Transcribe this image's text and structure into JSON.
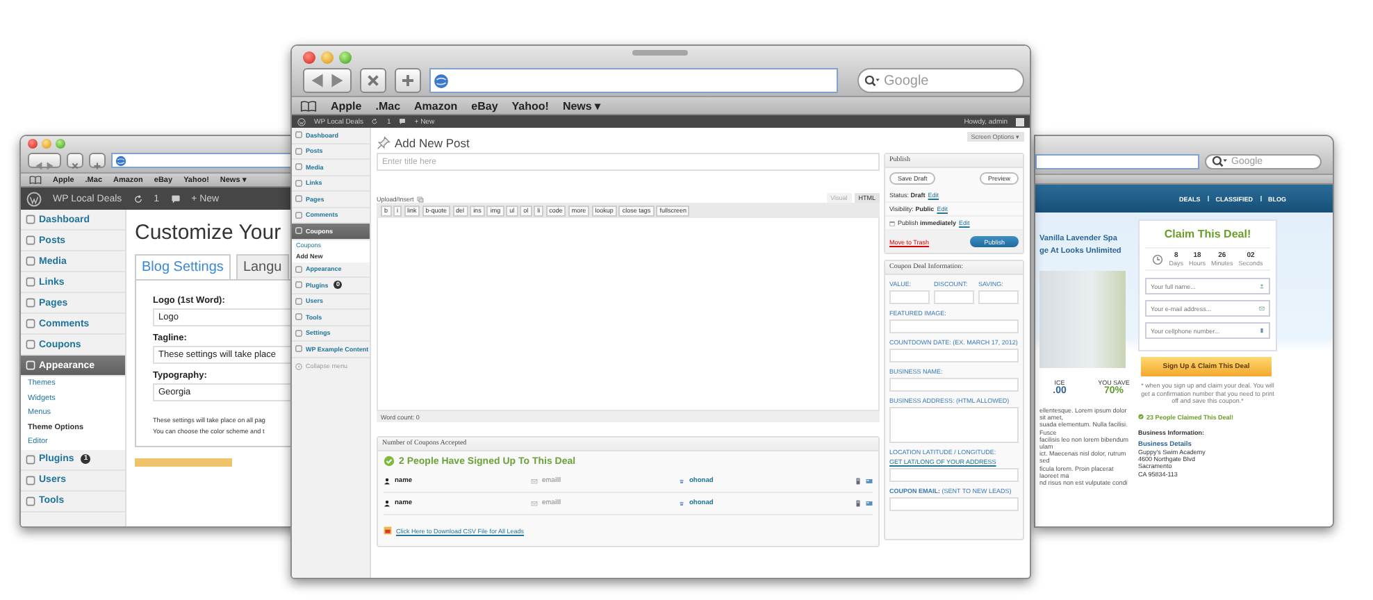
{
  "left_window": {
    "bookmarks": [
      "Apple",
      ".Mac",
      "Amazon",
      "eBay",
      "Yahoo!",
      "News ▾"
    ],
    "admin_bar": {
      "site": "WP Local Deals",
      "updates": "1",
      "new": "+ New"
    },
    "sidebar": [
      {
        "label": "Dashboard",
        "selected": false
      },
      {
        "label": "Posts",
        "selected": false
      },
      {
        "label": "Media",
        "selected": false
      },
      {
        "label": "Links",
        "selected": false
      },
      {
        "label": "Pages",
        "selected": false
      },
      {
        "label": "Comments",
        "selected": false
      },
      {
        "label": "Coupons",
        "selected": false
      },
      {
        "label": "Appearance",
        "selected": true,
        "children": [
          {
            "label": "Themes",
            "selected": false
          },
          {
            "label": "Widgets",
            "selected": false
          },
          {
            "label": "Menus",
            "selected": false
          },
          {
            "label": "Theme Options",
            "selected": true
          },
          {
            "label": "Editor",
            "selected": false
          }
        ]
      },
      {
        "label": "Plugins",
        "selected": false,
        "badge": "1"
      },
      {
        "label": "Users",
        "selected": false
      },
      {
        "label": "Tools",
        "selected": false
      }
    ],
    "heading": "Customize Your",
    "tabs": [
      {
        "label": "Blog Settings",
        "selected": true
      },
      {
        "label": "Langu",
        "selected": false
      }
    ],
    "fields": [
      {
        "label": "Logo (1st Word):",
        "value": "Logo"
      },
      {
        "label": "Tagline:",
        "value": "These settings will take place"
      },
      {
        "label": "Typography:",
        "value": "Georgia"
      }
    ],
    "notes": [
      "These settings will take place on all pag",
      "You can choose the color scheme and t"
    ]
  },
  "front_window": {
    "search_placeholder": "Google",
    "bookmarks": [
      "Apple",
      ".Mac",
      "Amazon",
      "eBay",
      "Yahoo!",
      "News ▾"
    ],
    "admin_bar": {
      "site": "WP Local Deals",
      "updates": "1",
      "new": "+ New",
      "greeting": "Howdy, admin"
    },
    "sidebar": [
      {
        "label": "Dashboard",
        "selected": false
      },
      {
        "label": "Posts",
        "selected": false
      },
      {
        "label": "Media",
        "selected": false
      },
      {
        "label": "Links",
        "selected": false
      },
      {
        "label": "Pages",
        "selected": false
      },
      {
        "label": "Comments",
        "selected": false
      },
      {
        "label": "Coupons",
        "selected": true,
        "children": [
          {
            "label": "Coupons",
            "selected": false
          },
          {
            "label": "Add New",
            "selected": true
          }
        ]
      },
      {
        "label": "Appearance",
        "selected": false
      },
      {
        "label": "Plugins",
        "selected": false,
        "badge": "0"
      },
      {
        "label": "Users",
        "selected": false
      },
      {
        "label": "Tools",
        "selected": false
      },
      {
        "label": "Settings",
        "selected": false
      },
      {
        "label": "WP Example Content",
        "selected": false
      }
    ],
    "collapse_label": "Collapse menu",
    "heading": "Add New Post",
    "screen_options": "Screen Options ▾",
    "title_placeholder": "Enter title here",
    "upload_label": "Upload/Insert",
    "editor_tabs": [
      {
        "label": "Visual",
        "selected": false
      },
      {
        "label": "HTML",
        "selected": true
      }
    ],
    "quicktags": [
      "b",
      "i",
      "link",
      "b-quote",
      "del",
      "ins",
      "img",
      "ul",
      "ol",
      "li",
      "code",
      "more",
      "lookup",
      "close tags",
      "fullscreen"
    ],
    "word_count": "Word count: 0",
    "leads_box": {
      "title": "Number of Coupons Accepted",
      "headline": "2 People Have Signed Up To This Deal",
      "rows": [
        {
          "name": "name",
          "email": "emailll",
          "phone": "ohonad"
        },
        {
          "name": "name",
          "email": "emailll",
          "phone": "ohonad"
        }
      ],
      "download_link": "Click Here to Download CSV File for All Leads"
    },
    "publish_box": {
      "title": "Publish",
      "save_draft": "Save Draft",
      "preview": "Preview",
      "lines": [
        {
          "text": "Status: **Draft**",
          "link": "Edit",
          "kind": "plain"
        },
        {
          "text": "Visibility: **Public**",
          "link": "Edit",
          "kind": "plain"
        },
        {
          "text": "Publish **immediately**",
          "link": "Edit",
          "kind": "calendar"
        }
      ],
      "trash": "Move to Trash",
      "publish": "Publish"
    },
    "deal_box": {
      "title": "Coupon Deal Information:",
      "short_fields": [
        "VALUE:",
        "DISCOUNT:",
        "SAVING:"
      ],
      "fields": [
        {
          "label": "FEATURED IMAGE:",
          "kind": "line"
        },
        {
          "label": "COUNTDOWN DATE: (EX. MARCH 17, 2012)",
          "kind": "line"
        },
        {
          "label": "BUSINESS NAME:",
          "kind": "line"
        },
        {
          "label": "BUSINESS ADDRESS: (HTML ALLOWED)",
          "kind": "area"
        },
        {
          "label": "LOCATION LATITUDE / LONGITUDE:",
          "link": "GET LAT/LONG OF YOUR ADDRESS",
          "kind": "line"
        },
        {
          "label": "**COUPON EMAIL:** (SENT TO NEW LEADS)",
          "kind": "line"
        }
      ]
    }
  },
  "right_window": {
    "search_placeholder": "Google",
    "nav": [
      "DEALS",
      "CLASSIFIED",
      "BLOG"
    ],
    "deal_title": [
      "Vanilla Lavender Spa",
      "ge At Looks Unlimited"
    ],
    "stats": [
      {
        "label": "ICE",
        "value": ".00",
        "kind": "price"
      },
      {
        "label": "YOU SAVE",
        "value": "70%",
        "kind": "saving"
      }
    ],
    "lorem": [
      "ellentesque. Lorem ipsum dolor sit amet,",
      "suada elementum. Nulla facilisi. Fusce",
      "facilisis leo non lorem bibendum ulam",
      "ict. Maecenas nisl dolor, rutrum sed",
      "ficula lorem. Proin placerat laoreet ma",
      "nd risus non est vulputate condi"
    ],
    "claim_box": {
      "title": "Claim This Deal!",
      "countdown": [
        {
          "value": "8",
          "unit": "Days"
        },
        {
          "value": "18",
          "unit": "Hours"
        },
        {
          "value": "26",
          "unit": "Minutes"
        },
        {
          "value": "02",
          "unit": "Seconds"
        }
      ],
      "fields": [
        {
          "placeholder": "Your full name...",
          "kind": "person"
        },
        {
          "placeholder": "Your e-mail address...",
          "kind": "mail"
        },
        {
          "placeholder": "Your cellphone number...",
          "kind": "phone"
        }
      ],
      "button": "Sign Up & Claim This Deal"
    },
    "note": "* when you sign up and claim your deal. You will get a confirmation number that you need to print off and save this coupon.*",
    "claimed": "23 People Claimed This Deal!",
    "business_heading": "Business Information:",
    "business_details": "Business Details",
    "address": [
      "Guppy's Swim Academy",
      "4600 Northgate Blvd",
      "Sacramento",
      "CA 95834-113"
    ]
  }
}
